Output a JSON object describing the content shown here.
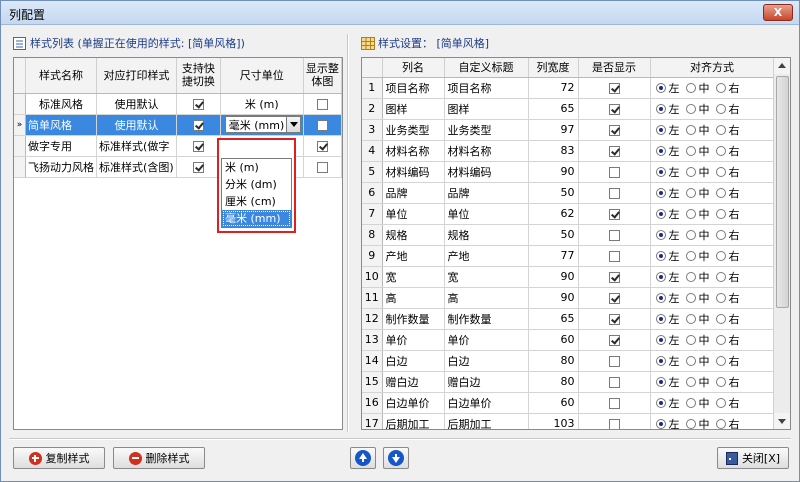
{
  "window": {
    "title": "列配置",
    "close_label": "X"
  },
  "left": {
    "section_title": "样式列表 (单握正在使用的样式: [简单风格])",
    "headers": [
      "样式名称",
      "对应打印样式",
      "支持快捷切换",
      "尺寸单位",
      "显示整体图"
    ],
    "rows": [
      {
        "name": "标准风格",
        "print": "使用默认",
        "quick": true,
        "unit": "米 (m)",
        "whole": false
      },
      {
        "name": "简单风格",
        "print": "使用默认",
        "quick": true,
        "unit": "毫米 (mm)",
        "whole": false
      },
      {
        "name": "做字专用",
        "print": "标准样式(做字",
        "quick": true,
        "unit": "",
        "whole": true
      },
      {
        "name": "飞扬动力风格",
        "print": "标准样式(含图)",
        "quick": true,
        "unit": "",
        "whole": false
      }
    ],
    "current_row_marker": "»",
    "unit_options": [
      "米 (m)",
      "分米 (dm)",
      "厘米 (cm)",
      "毫米 (mm)"
    ],
    "unit_selected": "毫米 (mm)"
  },
  "right": {
    "section_title": "样式设置： [简单风格]",
    "headers": [
      "",
      "列名",
      "自定义标题",
      "列宽度",
      "是否显示",
      "对齐方式"
    ],
    "align_labels": [
      "左",
      "中",
      "右"
    ],
    "rows": [
      {
        "n": "1",
        "name": "项目名称",
        "title": "项目名称",
        "width": "72",
        "show": true,
        "align": 0
      },
      {
        "n": "2",
        "name": "图样",
        "title": "图样",
        "width": "65",
        "show": true,
        "align": 0
      },
      {
        "n": "3",
        "name": "业务类型",
        "title": "业务类型",
        "width": "97",
        "show": true,
        "align": 0
      },
      {
        "n": "4",
        "name": "材料名称",
        "title": "材料名称",
        "width": "83",
        "show": true,
        "align": 0
      },
      {
        "n": "5",
        "name": "材料编码",
        "title": "材料编码",
        "width": "90",
        "show": false,
        "align": 0
      },
      {
        "n": "6",
        "name": "品牌",
        "title": "品牌",
        "width": "50",
        "show": false,
        "align": 0
      },
      {
        "n": "7",
        "name": "单位",
        "title": "单位",
        "width": "62",
        "show": true,
        "align": 0
      },
      {
        "n": "8",
        "name": "规格",
        "title": "规格",
        "width": "50",
        "show": false,
        "align": 0
      },
      {
        "n": "9",
        "name": "产地",
        "title": "产地",
        "width": "77",
        "show": false,
        "align": 0
      },
      {
        "n": "10",
        "name": "宽",
        "title": "宽",
        "width": "90",
        "show": true,
        "align": 0
      },
      {
        "n": "11",
        "name": "高",
        "title": "高",
        "width": "90",
        "show": true,
        "align": 0
      },
      {
        "n": "12",
        "name": "制作数量",
        "title": "制作数量",
        "width": "65",
        "show": true,
        "align": 0
      },
      {
        "n": "13",
        "name": "单价",
        "title": "单价",
        "width": "60",
        "show": true,
        "align": 0
      },
      {
        "n": "14",
        "name": "白边",
        "title": "白边",
        "width": "80",
        "show": false,
        "align": 0
      },
      {
        "n": "15",
        "name": "赠白边",
        "title": "赠白边",
        "width": "80",
        "show": false,
        "align": 0
      },
      {
        "n": "16",
        "name": "白边单价",
        "title": "白边单价",
        "width": "60",
        "show": false,
        "align": 0
      },
      {
        "n": "17",
        "name": "后期加工",
        "title": "后期加工",
        "width": "103",
        "show": false,
        "align": 0
      }
    ]
  },
  "buttons": {
    "copy": "复制样式",
    "delete": "删除样式",
    "close": "关闭[X]"
  },
  "colors": {
    "selection": "#3a88e0",
    "highlight_border": "#e02020",
    "section_text": "#1a3a8a"
  }
}
